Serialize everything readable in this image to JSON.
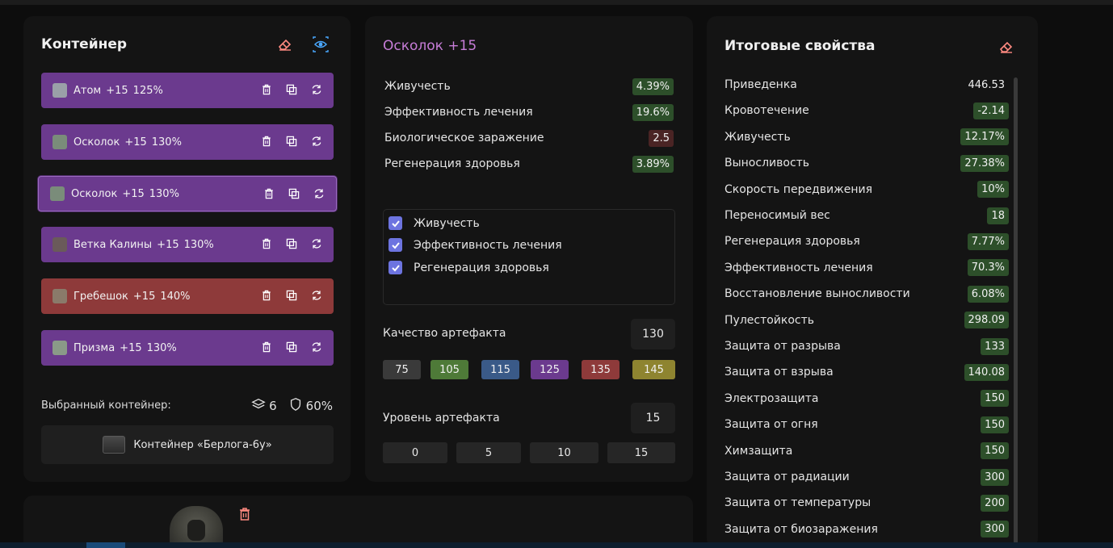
{
  "container_panel": {
    "title": "Контейнер",
    "artifacts": [
      {
        "name": "Атом",
        "level": "+15",
        "pct": "125%",
        "color": "#6b3a8e"
      },
      {
        "name": "Осколок",
        "level": "+15",
        "pct": "130%",
        "color": "#6b3a8e"
      },
      {
        "name": "Осколок",
        "level": "+15",
        "pct": "130%",
        "color": "#6b3a8e",
        "active": true
      },
      {
        "name": "Ветка Калины",
        "level": "+15",
        "pct": "130%",
        "color": "#6b3a8e"
      },
      {
        "name": "Гребешок",
        "level": "+15",
        "pct": "140%",
        "color": "#8e3a3a"
      },
      {
        "name": "Призма",
        "level": "+15",
        "pct": "130%",
        "color": "#6b3a8e"
      }
    ],
    "selected_label": "Выбранный контейнер:",
    "slots": "6",
    "protection": "60%",
    "container_name": "Контейнер «Берлога-6у»"
  },
  "artefact_panel": {
    "title": "Осколок +15",
    "properties": [
      {
        "name": "Живучесть",
        "value": "4.39%",
        "tone": "green"
      },
      {
        "name": "Эффективность лечения",
        "value": "19.6%",
        "tone": "green"
      },
      {
        "name": "Биологическое заражение",
        "value": "2.5",
        "tone": "darkred"
      },
      {
        "name": "Регенерация здоровья",
        "value": "3.89%",
        "tone": "green"
      }
    ],
    "filters": [
      {
        "label": "Живучесть",
        "checked": true
      },
      {
        "label": "Эффективность лечения",
        "checked": true
      },
      {
        "label": "Регенерация здоровья",
        "checked": true
      }
    ],
    "quality_label": "Качество артефакта",
    "quality_value": "130",
    "quality_options": [
      {
        "value": "75",
        "color": "#3a3a3a"
      },
      {
        "value": "105",
        "color": "#4e7a38"
      },
      {
        "value": "115",
        "color": "#3a5a88"
      },
      {
        "value": "125",
        "color": "#6b3a8e"
      },
      {
        "value": "135",
        "color": "#8e3a3a"
      },
      {
        "value": "145",
        "color": "#8e8430"
      }
    ],
    "level_label": "Уровень артефакта",
    "level_value": "15",
    "level_options": [
      "0",
      "5",
      "10",
      "15"
    ]
  },
  "totals_panel": {
    "title": "Итоговые свойства",
    "properties": [
      {
        "name": "Приведенка",
        "value": "446.53",
        "tone": "plain"
      },
      {
        "name": "Кровотечение",
        "value": "-2.14",
        "tone": "green"
      },
      {
        "name": "Живучесть",
        "value": "12.17%",
        "tone": "green"
      },
      {
        "name": "Выносливость",
        "value": "27.38%",
        "tone": "green"
      },
      {
        "name": "Скорость передвижения",
        "value": "10%",
        "tone": "green"
      },
      {
        "name": "Переносимый вес",
        "value": "18",
        "tone": "green"
      },
      {
        "name": "Регенерация здоровья",
        "value": "7.77%",
        "tone": "green"
      },
      {
        "name": "Эффективность лечения",
        "value": "70.3%",
        "tone": "green"
      },
      {
        "name": "Восстановление выносливости",
        "value": "6.08%",
        "tone": "green"
      },
      {
        "name": "Пулестойкость",
        "value": "298.09",
        "tone": "green"
      },
      {
        "name": "Защита от разрыва",
        "value": "133",
        "tone": "green"
      },
      {
        "name": "Защита от взрыва",
        "value": "140.08",
        "tone": "green"
      },
      {
        "name": "Электрозащита",
        "value": "150",
        "tone": "green"
      },
      {
        "name": "Защита от огня",
        "value": "150",
        "tone": "green"
      },
      {
        "name": "Химзащита",
        "value": "150",
        "tone": "green"
      },
      {
        "name": "Защита от радиации",
        "value": "300",
        "tone": "green"
      },
      {
        "name": "Защита от температуры",
        "value": "200",
        "tone": "green"
      },
      {
        "name": "Защита от биозаражения",
        "value": "300",
        "tone": "green"
      }
    ]
  },
  "icons": {
    "eraser": "eraser-icon",
    "eye": "eye-icon",
    "trash": "trash-icon",
    "copy": "copy-icon",
    "refresh": "refresh-icon",
    "layers": "layers-icon",
    "shield": "shield-icon"
  },
  "colors": {
    "accent_purple": "#c77dd8",
    "eye_blue": "#4aa8ff",
    "eraser_pink": "#ff8a80",
    "check_blue": "#6d74e0"
  }
}
